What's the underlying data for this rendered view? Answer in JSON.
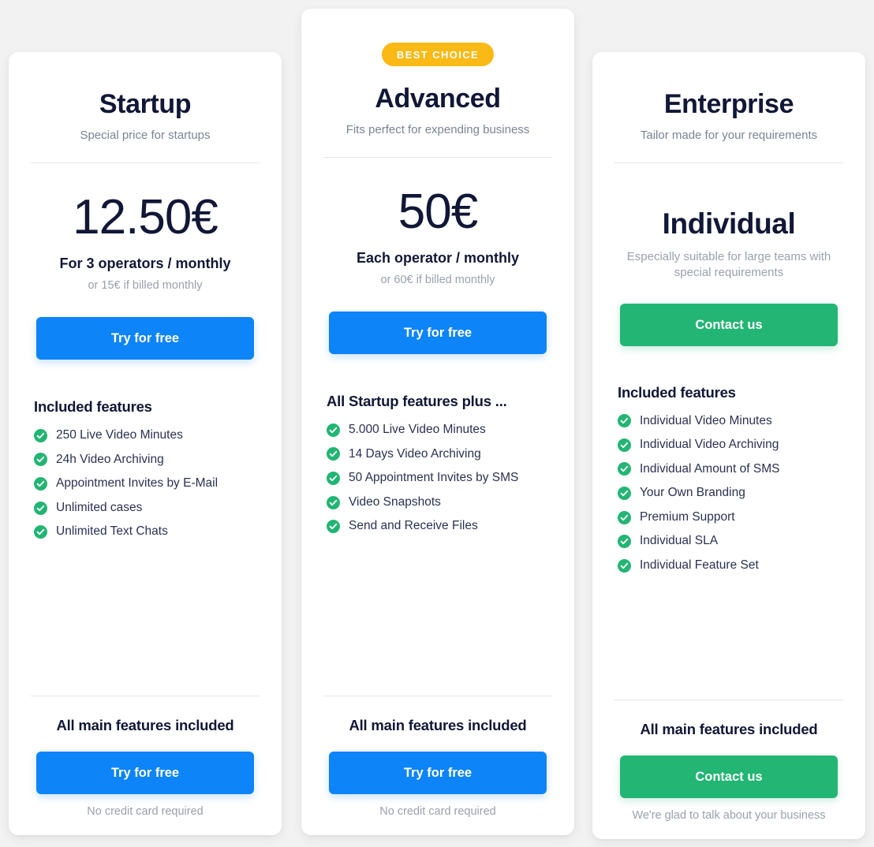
{
  "page": {
    "background_color": "#f2f2f2",
    "accent_blue": "#0d84f7",
    "accent_green": "#22b573",
    "accent_amber": "#fbb915",
    "heading_color": "#111736"
  },
  "plans": [
    {
      "id": "startup",
      "badge": null,
      "name": "Startup",
      "tagline": "Special price for startups",
      "price": "12.50€",
      "price_is_word": false,
      "price_sub": "For 3 operators / monthly",
      "price_note": "or 15€ if billed monthly",
      "price_desc": null,
      "cta_top_label": "Try for free",
      "cta_style": "blue",
      "features_title": "Included features",
      "features": [
        "250 Live Video Minutes",
        "24h Video Archiving",
        "Appointment Invites by E-Mail",
        "Unlimited cases",
        "Unlimited Text Chats"
      ],
      "footer_title": "All main features included",
      "cta_bottom_label": "Try for free",
      "footer_note": "No credit card required"
    },
    {
      "id": "advanced",
      "badge": "BEST CHOICE",
      "name": "Advanced",
      "tagline": "Fits perfect for expending business",
      "price": "50€",
      "price_is_word": false,
      "price_sub": "Each operator / monthly",
      "price_note": "or 60€ if billed monthly",
      "price_desc": null,
      "cta_top_label": "Try for free",
      "cta_style": "blue",
      "features_title": "All Startup features plus ...",
      "features": [
        "5.000 Live Video Minutes",
        "14 Days Video Archiving",
        "50 Appointment Invites by SMS",
        "Video Snapshots",
        "Send and Receive Files"
      ],
      "footer_title": "All main features included",
      "cta_bottom_label": "Try for free",
      "footer_note": "No credit card required"
    },
    {
      "id": "enterprise",
      "badge": null,
      "name": "Enterprise",
      "tagline": "Tailor made for your requirements",
      "price": "Individual",
      "price_is_word": true,
      "price_sub": null,
      "price_note": null,
      "price_desc": "Especially suitable for large teams with special requirements",
      "cta_top_label": "Contact us",
      "cta_style": "green",
      "features_title": "Included features",
      "features": [
        "Individual Video Minutes",
        "Individual Video Archiving",
        "Individual Amount of SMS",
        "Your Own Branding",
        "Premium Support",
        "Individual SLA",
        "Individual Feature Set"
      ],
      "footer_title": "All main features included",
      "cta_bottom_label": "Contact us",
      "footer_note": "We're glad to talk about your business"
    }
  ],
  "icons": {
    "feature_check": "check-circle-icon"
  }
}
